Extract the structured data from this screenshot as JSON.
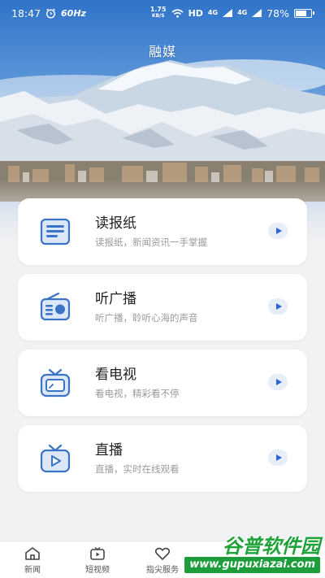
{
  "status_bar": {
    "time": "18:47",
    "alarm_icon": "alarm-icon",
    "fps": "60Hz",
    "net_speed_value": "1.75",
    "net_speed_unit": "KB/S",
    "hd_label": "HD",
    "network_1": "4G",
    "network_2": "4G",
    "battery_percent": "78%",
    "battery_level": 0.78
  },
  "header": {
    "title": "融媒"
  },
  "cards": [
    {
      "title": "读报纸",
      "subtitle": "读报纸，新闻资讯一手掌握",
      "icon": "newspaper-icon"
    },
    {
      "title": "听广播",
      "subtitle": "听广播，聆听心海的声音",
      "icon": "radio-icon"
    },
    {
      "title": "看电视",
      "subtitle": "看电视，精彩看不停",
      "icon": "tv-icon"
    },
    {
      "title": "直播",
      "subtitle": "直播，实时在线观看",
      "icon": "live-tv-icon"
    }
  ],
  "bottom_nav": [
    {
      "label": "新闻",
      "icon": "news-home-icon"
    },
    {
      "label": "短视频",
      "icon": "short-video-icon"
    },
    {
      "label": "指尖服务",
      "icon": "heart-service-icon"
    }
  ],
  "watermark": {
    "brand": "谷普软件园",
    "url": "www.gupuxiazai.com"
  },
  "colors": {
    "accent": "#2a67d4",
    "icon_blue": "#3a73c8",
    "background": "#f1f2f4",
    "card": "#ffffff"
  }
}
